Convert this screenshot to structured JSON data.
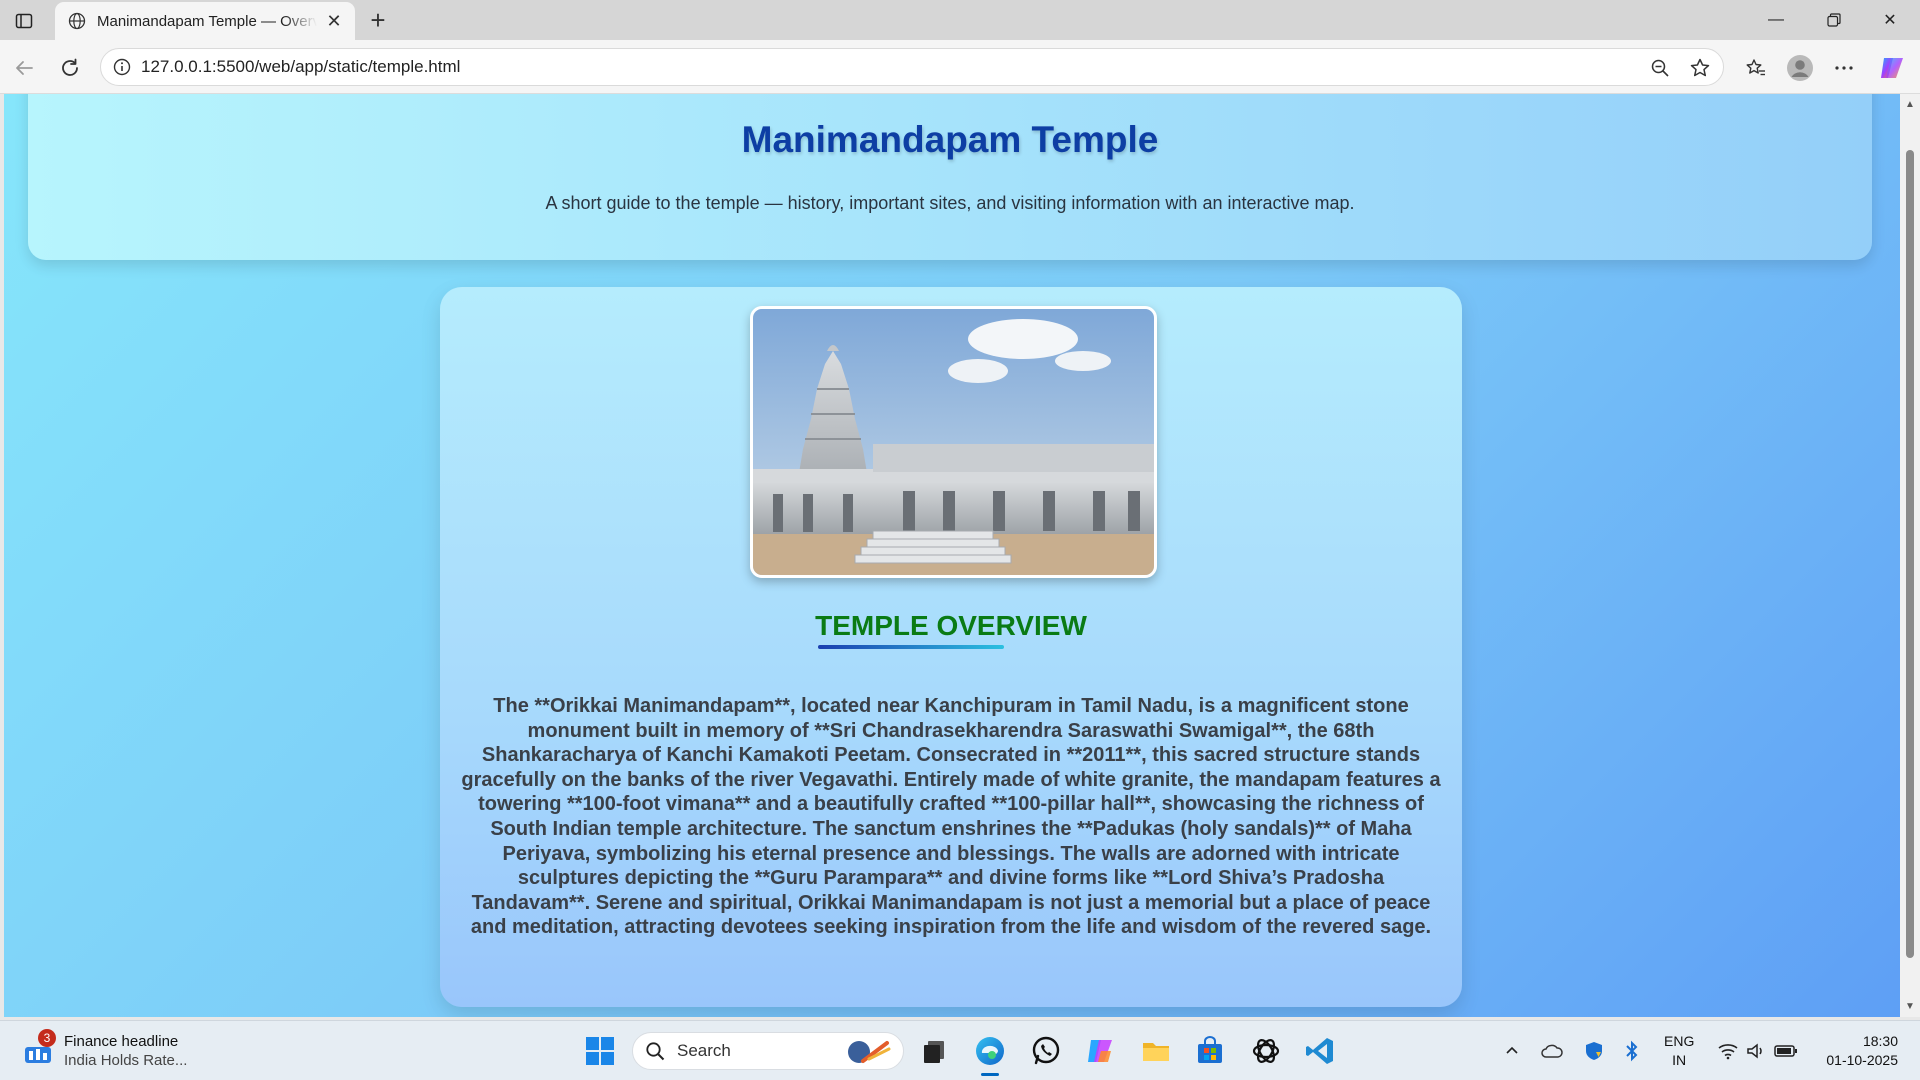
{
  "browser": {
    "tab_title": "Manimandapam Temple — Overview",
    "url": "127.0.0.1:5500/web/app/static/temple.html"
  },
  "page": {
    "title": "Manimandapam Temple",
    "subtitle": "A short guide to the temple — history, important sites, and visiting information with an interactive map.",
    "section_title": "TEMPLE OVERVIEW",
    "overview_text": "The **Orikkai Manimandapam**, located near Kanchipuram in Tamil Nadu, is a magnificent stone monument built in memory of **Sri Chandrasekharendra Saraswathi Swamigal**, the 68th Shankaracharya of Kanchi Kamakoti Peetam. Consecrated in **2011**, this sacred structure stands gracefully on the banks of the river Vegavathi. Entirely made of white granite, the mandapam features a towering **100-foot vimana** and a beautifully crafted **100-pillar hall**, showcasing the richness of South Indian temple architecture. The sanctum enshrines the **Padukas (holy sandals)** of Maha Periyava, symbolizing his eternal presence and blessings. The walls are adorned with intricate sculptures depicting the **Guru Parampara** and divine forms like **Lord Shiva’s Pradosha Tandavam**. Serene and spiritual, Orikkai Manimandapam is not just a memorial but a place of peace and meditation, attracting devotees seeking inspiration from the life and wisdom of the revered sage."
  },
  "taskbar": {
    "widget_badge": "3",
    "widget_title": "Finance headline",
    "widget_subtitle": "India Holds Rate...",
    "search_placeholder": "Search",
    "lang_line1": "ENG",
    "lang_line2": "IN",
    "time": "18:30",
    "date": "01-10-2025"
  },
  "colors": {
    "title": "#0d3ea4",
    "section_title": "#0a7b14",
    "text": "#3a4048"
  }
}
